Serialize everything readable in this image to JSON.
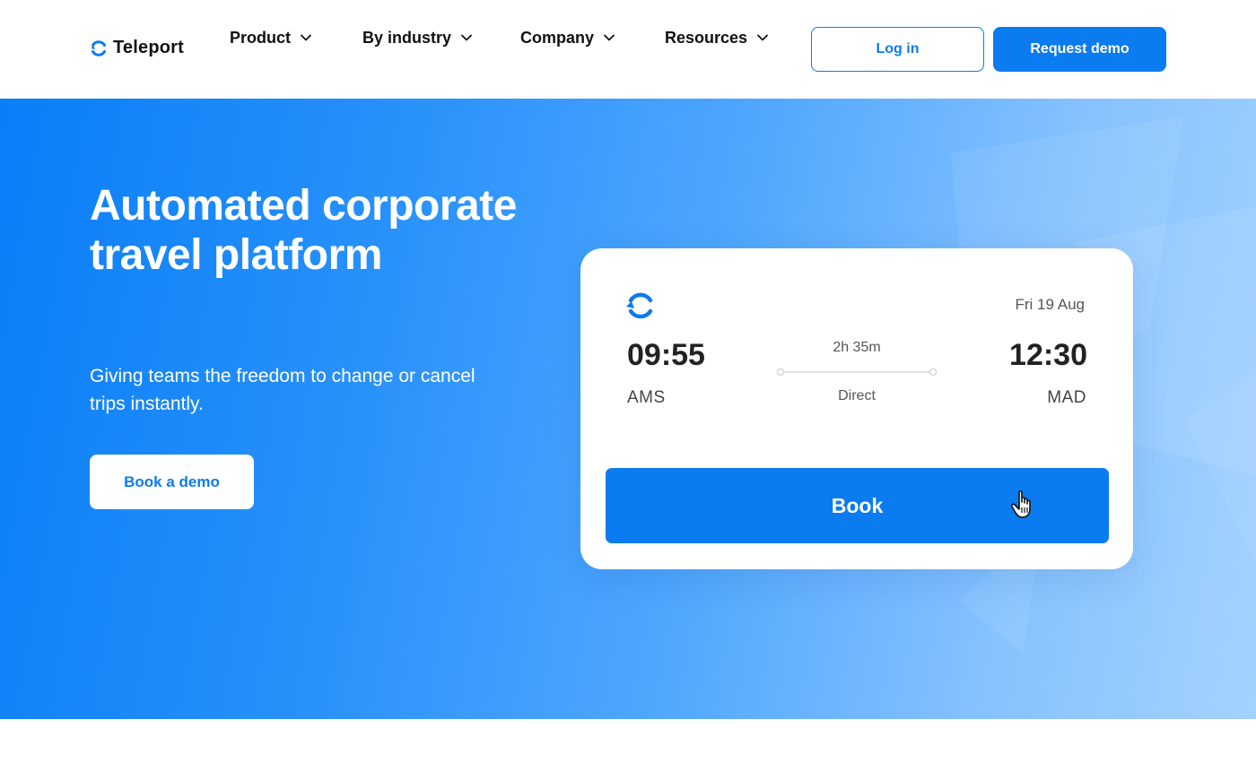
{
  "header": {
    "logo_text": "Teleport",
    "nav": [
      {
        "label": "Product"
      },
      {
        "label": "By industry"
      },
      {
        "label": "Company"
      },
      {
        "label": "Resources"
      }
    ],
    "login_label": "Log in",
    "request_demo_label": "Request demo"
  },
  "hero": {
    "title": "Automated corporate travel platform",
    "subtitle": "Giving teams the freedom to change or cancel trips instantly.",
    "cta_label": "Book a demo"
  },
  "flight_card": {
    "date": "Fri 19 Aug",
    "departure_time": "09:55",
    "departure_code": "AMS",
    "arrival_time": "12:30",
    "arrival_code": "MAD",
    "duration": "2h 35m",
    "stops": "Direct",
    "book_label": "Book"
  },
  "colors": {
    "brand_blue": "#0b7bf0",
    "hero_light": "#a4d2ff",
    "white": "#ffffff"
  },
  "icons": {
    "logo": "teleport-logo-icon",
    "chevron": "chevron-down-icon",
    "cursor": "hand-pointer-icon"
  }
}
